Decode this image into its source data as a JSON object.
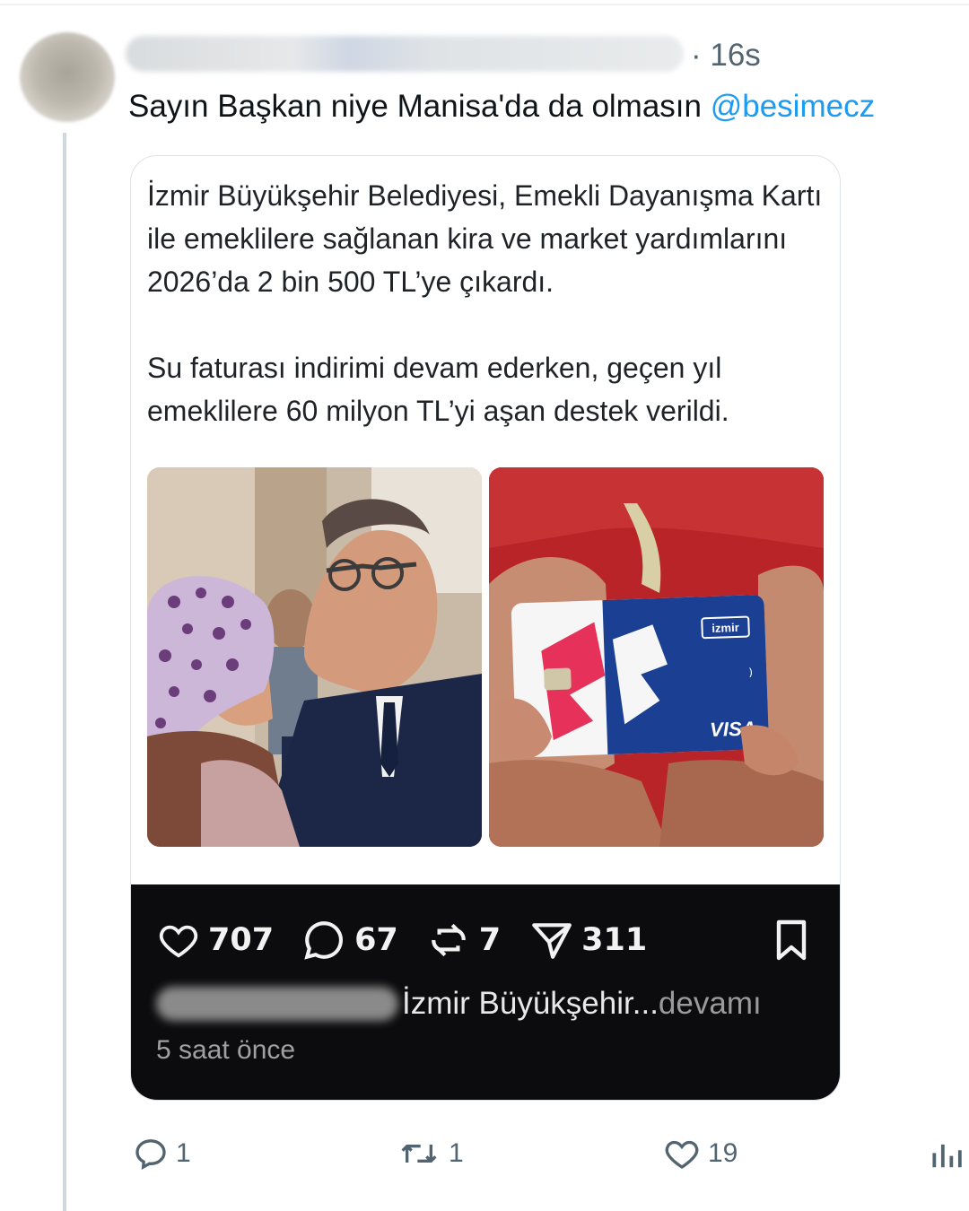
{
  "tweet": {
    "time": "· 16s",
    "text": "Sayın Başkan niye Manisa'da da olmasın ",
    "mention": "@besimecz"
  },
  "quoted": {
    "paragraph1": "İzmir Büyükşehir Belediyesi, Emekli Dayanışma Kartı ile emeklilere sağlanan kira ve market yardımlarını 2026’da 2 bin 500 TL’ye çıkardı.",
    "paragraph2": "Su faturası indirimi devam ederken, geçen yıl emeklilere 60 milyon TL’yi aşan destek verildi.",
    "card_brand": "izmir",
    "card_network": "VISA",
    "stats": {
      "likes": "707",
      "comments": "67",
      "reposts": "7",
      "shares": "311"
    },
    "caption": "İzmir Büyükşehir...",
    "caption_more": " devamı",
    "time_ago": "5 saat önce"
  },
  "actions": {
    "replies": "1",
    "retweets": "1",
    "likes": "19"
  },
  "colors": {
    "accent": "#1d9bf0",
    "text": "#0f1419",
    "muted": "#536471",
    "dark_panel": "#0c0c0e"
  },
  "icons": [
    "reply-icon",
    "retweet-icon",
    "like-icon",
    "analytics-icon",
    "heart-icon",
    "comment-icon",
    "repost-icon",
    "share-icon",
    "bookmark-icon"
  ]
}
